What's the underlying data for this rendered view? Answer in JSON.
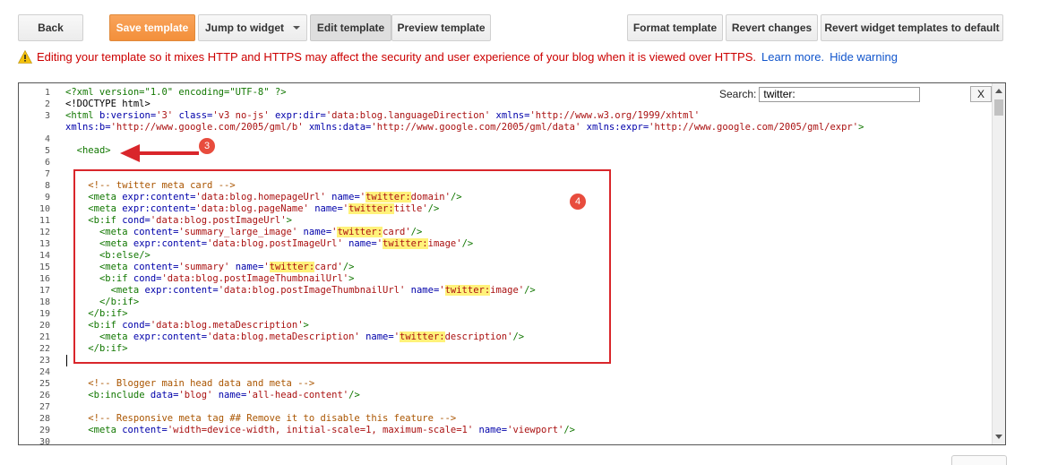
{
  "toolbar": {
    "back": "Back",
    "save_template": "Save template",
    "jump_to_widget": "Jump to widget",
    "edit_template": "Edit template",
    "preview_template": "Preview template",
    "format_template": "Format template",
    "revert_changes": "Revert changes",
    "revert_widget_templates": "Revert widget templates to default"
  },
  "warning": {
    "message": "Editing your template so it mixes HTTP and HTTPS may affect the security and user experience of your blog when it is viewed over HTTPS.",
    "learn_more": "Learn more.",
    "hide_warning": "Hide warning"
  },
  "search": {
    "label": "Search:",
    "value": "twitter:",
    "close": "X"
  },
  "annotations": {
    "arrow_badge": "3",
    "box_badge": "4"
  },
  "colors": {
    "accent_orange": "#f39237",
    "annotation_red": "#d9262b",
    "warning_red": "#cc0000",
    "link_blue": "#1155cc",
    "highlight": "#fff27a"
  },
  "icons": {
    "warning": "warning-triangle-icon",
    "dropdown": "caret-down-icon"
  },
  "lines": [
    {
      "n": "1",
      "segs": [
        [
          "t",
          "<?xml version=\"1.0\" encoding=\"UTF-8\" ?>"
        ]
      ]
    },
    {
      "n": "2",
      "segs": [
        [
          "p",
          "<!DOCTYPE html>"
        ]
      ]
    },
    {
      "n": "3",
      "segs": [
        [
          "t",
          "<html "
        ],
        [
          "a",
          "b:version="
        ],
        [
          "s",
          "'3'"
        ],
        [
          "p",
          " "
        ],
        [
          "a",
          "class="
        ],
        [
          "s",
          "'v3 no-js'"
        ],
        [
          "p",
          " "
        ],
        [
          "a",
          "expr:dir="
        ],
        [
          "s",
          "'data:blog.languageDirection'"
        ],
        [
          "p",
          " "
        ],
        [
          "a",
          "xmlns="
        ],
        [
          "s",
          "'http://www.w3.org/1999/xhtml'"
        ]
      ]
    },
    {
      "n": "",
      "segs": [
        [
          "a",
          "xmlns:b="
        ],
        [
          "s",
          "'http://www.google.com/2005/gml/b'"
        ],
        [
          "p",
          " "
        ],
        [
          "a",
          "xmlns:data="
        ],
        [
          "s",
          "'http://www.google.com/2005/gml/data'"
        ],
        [
          "p",
          " "
        ],
        [
          "a",
          "xmlns:expr="
        ],
        [
          "s",
          "'http://www.google.com/2005/gml/expr'"
        ],
        [
          "t",
          ">"
        ]
      ]
    },
    {
      "n": "4",
      "segs": []
    },
    {
      "n": "5",
      "segs": [
        [
          "p",
          "  "
        ],
        [
          "t",
          "<head>"
        ]
      ]
    },
    {
      "n": "6",
      "segs": []
    },
    {
      "n": "7",
      "segs": []
    },
    {
      "n": "8",
      "segs": [
        [
          "p",
          "    "
        ],
        [
          "c",
          "<!-- twitter meta card -->"
        ]
      ]
    },
    {
      "n": "9",
      "segs": [
        [
          "p",
          "    "
        ],
        [
          "t",
          "<meta "
        ],
        [
          "a",
          "expr:content="
        ],
        [
          "s",
          "'data:blog.homepageUrl'"
        ],
        [
          "p",
          " "
        ],
        [
          "a",
          "name="
        ],
        [
          "s",
          "'"
        ],
        [
          "hs",
          "twitter:"
        ],
        [
          "s",
          "domain'"
        ],
        [
          "t",
          "/>"
        ]
      ]
    },
    {
      "n": "10",
      "segs": [
        [
          "p",
          "    "
        ],
        [
          "t",
          "<meta "
        ],
        [
          "a",
          "expr:content="
        ],
        [
          "s",
          "'data:blog.pageName'"
        ],
        [
          "p",
          " "
        ],
        [
          "a",
          "name="
        ],
        [
          "s",
          "'"
        ],
        [
          "hs",
          "twitter:"
        ],
        [
          "s",
          "title'"
        ],
        [
          "t",
          "/>"
        ]
      ]
    },
    {
      "n": "11",
      "segs": [
        [
          "p",
          "    "
        ],
        [
          "t",
          "<b:if "
        ],
        [
          "a",
          "cond="
        ],
        [
          "s",
          "'data:blog.postImageUrl'"
        ],
        [
          "t",
          ">"
        ]
      ]
    },
    {
      "n": "12",
      "segs": [
        [
          "p",
          "      "
        ],
        [
          "t",
          "<meta "
        ],
        [
          "a",
          "content="
        ],
        [
          "s",
          "'summary_large_image'"
        ],
        [
          "p",
          " "
        ],
        [
          "a",
          "name="
        ],
        [
          "s",
          "'"
        ],
        [
          "hs",
          "twitter:"
        ],
        [
          "s",
          "card'"
        ],
        [
          "t",
          "/>"
        ]
      ]
    },
    {
      "n": "13",
      "segs": [
        [
          "p",
          "      "
        ],
        [
          "t",
          "<meta "
        ],
        [
          "a",
          "expr:content="
        ],
        [
          "s",
          "'data:blog.postImageUrl'"
        ],
        [
          "p",
          " "
        ],
        [
          "a",
          "name="
        ],
        [
          "s",
          "'"
        ],
        [
          "hs",
          "twitter:"
        ],
        [
          "s",
          "image'"
        ],
        [
          "t",
          "/>"
        ]
      ]
    },
    {
      "n": "14",
      "segs": [
        [
          "p",
          "      "
        ],
        [
          "t",
          "<b:else/>"
        ]
      ]
    },
    {
      "n": "15",
      "segs": [
        [
          "p",
          "      "
        ],
        [
          "t",
          "<meta "
        ],
        [
          "a",
          "content="
        ],
        [
          "s",
          "'summary'"
        ],
        [
          "p",
          " "
        ],
        [
          "a",
          "name="
        ],
        [
          "s",
          "'"
        ],
        [
          "hs",
          "twitter:"
        ],
        [
          "s",
          "card'"
        ],
        [
          "t",
          "/>"
        ]
      ]
    },
    {
      "n": "16",
      "segs": [
        [
          "p",
          "      "
        ],
        [
          "t",
          "<b:if "
        ],
        [
          "a",
          "cond="
        ],
        [
          "s",
          "'data:blog.postImageThumbnailUrl'"
        ],
        [
          "t",
          ">"
        ]
      ]
    },
    {
      "n": "17",
      "segs": [
        [
          "p",
          "        "
        ],
        [
          "t",
          "<meta "
        ],
        [
          "a",
          "expr:content="
        ],
        [
          "s",
          "'data:blog.postImageThumbnailUrl'"
        ],
        [
          "p",
          " "
        ],
        [
          "a",
          "name="
        ],
        [
          "s",
          "'"
        ],
        [
          "hs",
          "twitter:"
        ],
        [
          "s",
          "image'"
        ],
        [
          "t",
          "/>"
        ]
      ]
    },
    {
      "n": "18",
      "segs": [
        [
          "p",
          "      "
        ],
        [
          "t",
          "</b:if>"
        ]
      ]
    },
    {
      "n": "19",
      "segs": [
        [
          "p",
          "    "
        ],
        [
          "t",
          "</b:if>"
        ]
      ]
    },
    {
      "n": "20",
      "segs": [
        [
          "p",
          "    "
        ],
        [
          "t",
          "<b:if "
        ],
        [
          "a",
          "cond="
        ],
        [
          "s",
          "'data:blog.metaDescription'"
        ],
        [
          "t",
          ">"
        ]
      ]
    },
    {
      "n": "21",
      "segs": [
        [
          "p",
          "      "
        ],
        [
          "t",
          "<meta "
        ],
        [
          "a",
          "expr:content="
        ],
        [
          "s",
          "'data:blog.metaDescription'"
        ],
        [
          "p",
          " "
        ],
        [
          "a",
          "name="
        ],
        [
          "s",
          "'"
        ],
        [
          "hs",
          "twitter:"
        ],
        [
          "s",
          "description'"
        ],
        [
          "t",
          "/>"
        ]
      ]
    },
    {
      "n": "22",
      "segs": [
        [
          "p",
          "    "
        ],
        [
          "t",
          "</b:if>"
        ]
      ]
    },
    {
      "n": "23",
      "segs": []
    },
    {
      "n": "24",
      "segs": []
    },
    {
      "n": "25",
      "segs": [
        [
          "p",
          "    "
        ],
        [
          "c",
          "<!-- Blogger main head data and meta -->"
        ]
      ]
    },
    {
      "n": "26",
      "segs": [
        [
          "p",
          "    "
        ],
        [
          "t",
          "<b:include "
        ],
        [
          "a",
          "data="
        ],
        [
          "s",
          "'blog'"
        ],
        [
          "p",
          " "
        ],
        [
          "a",
          "name="
        ],
        [
          "s",
          "'all-head-content'"
        ],
        [
          "t",
          "/>"
        ]
      ]
    },
    {
      "n": "27",
      "segs": []
    },
    {
      "n": "28",
      "segs": [
        [
          "p",
          "    "
        ],
        [
          "c",
          "<!-- Responsive meta tag ## Remove it to disable this feature -->"
        ]
      ]
    },
    {
      "n": "29",
      "segs": [
        [
          "p",
          "    "
        ],
        [
          "t",
          "<meta "
        ],
        [
          "a",
          "content="
        ],
        [
          "s",
          "'width=device-width, initial-scale=1, maximum-scale=1'"
        ],
        [
          "p",
          " "
        ],
        [
          "a",
          "name="
        ],
        [
          "s",
          "'viewport'"
        ],
        [
          "t",
          "/>"
        ]
      ]
    },
    {
      "n": "30",
      "segs": []
    }
  ]
}
